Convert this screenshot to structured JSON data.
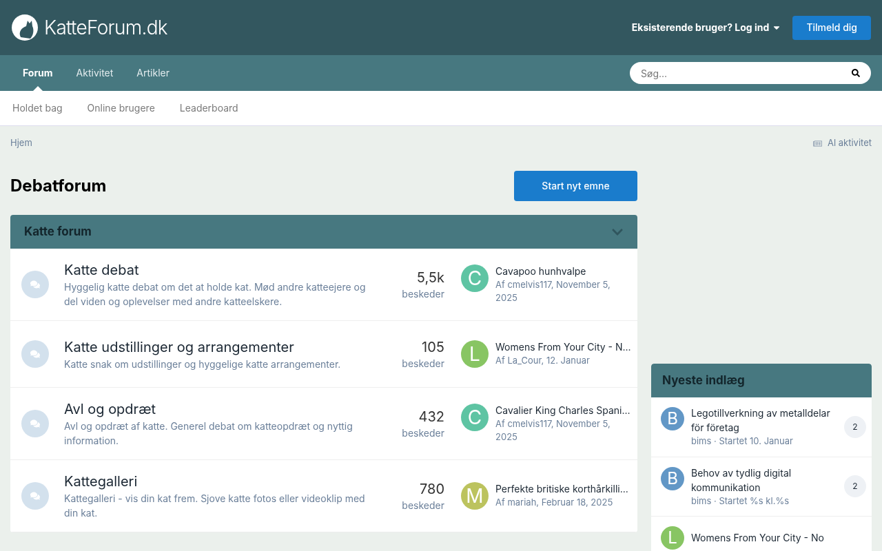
{
  "header": {
    "logo_text": "KatteForum.dk",
    "login": "Eksisterende bruger? Log ind",
    "signup": "Tilmeld dig"
  },
  "nav": {
    "tabs": [
      {
        "label": "Forum",
        "selected": true
      },
      {
        "label": "Aktivitet",
        "selected": false
      },
      {
        "label": "Artikler",
        "selected": false
      }
    ],
    "search": {
      "placeholder": "Søg..."
    }
  },
  "subnav": [
    "Holdet bag",
    "Online brugere",
    "Leaderboard"
  ],
  "breadcrumb": "Hjem",
  "all_activity": "Al aktivitet",
  "page_title": "Debatforum",
  "start_button": "Start nyt emne",
  "category": {
    "title": "Katte forum",
    "expanded": true,
    "forums": [
      {
        "name": "Katte debat",
        "description": "Hyggelig katte debat om det at holde kat. Mød andre katteejere og del viden og oplevelser med andre katteelskere.",
        "count": "5,5k",
        "count_label": "beskeder",
        "avatar": "C",
        "color": "#5ec4a3",
        "last_title": "Cavapoo hunhvalpe",
        "last_meta": "Af cmelvis117, November 5, 2025"
      },
      {
        "name": "Katte udstillinger og arrangementer",
        "description": "Katte snak om udstillinger og hyggelige katte arrangementer.",
        "count": "105",
        "count_label": "beskeder",
        "avatar": "L",
        "color": "#88c563",
        "last_title": "Womens From Your City - N...",
        "last_meta": "Af La_Cour, 12. Januar"
      },
      {
        "name": "Avl og opdræt",
        "description": "Avl og opdræt af katte. Generel debat om katteopdræt og nyttig information.",
        "count": "432",
        "count_label": "beskeder",
        "avatar": "C",
        "color": "#5ec4a3",
        "last_title": "Cavalier King Charles Spani...",
        "last_meta": "Af cmelvis117, November 5, 2025"
      },
      {
        "name": "Kattegalleri",
        "description": "Kattegalleri - vis din kat frem. Sjove katte fotos eller videoklip med din kat.",
        "count": "780",
        "count_label": "beskeder",
        "avatar": "M",
        "color": "#bcc35e",
        "last_title": "Perfekte britiske korthårkilli...",
        "last_meta": "Af mariah, Februar 18, 2025"
      }
    ]
  },
  "sidebar": {
    "title": "Nyeste indlæg",
    "items": [
      {
        "avatar": "B",
        "color": "#6297c6",
        "title": "Legotillverkning av metalldelar för företag",
        "meta": "bims · Startet 10. Januar",
        "replies": "2"
      },
      {
        "avatar": "B",
        "color": "#6297c6",
        "title": "Behov av tydlig digital kommunikation",
        "meta": "bims · Startet %s kl.%s",
        "replies": "2"
      },
      {
        "avatar": "L",
        "color": "#88c563",
        "title": "Womens From Your City - No"
      }
    ]
  }
}
